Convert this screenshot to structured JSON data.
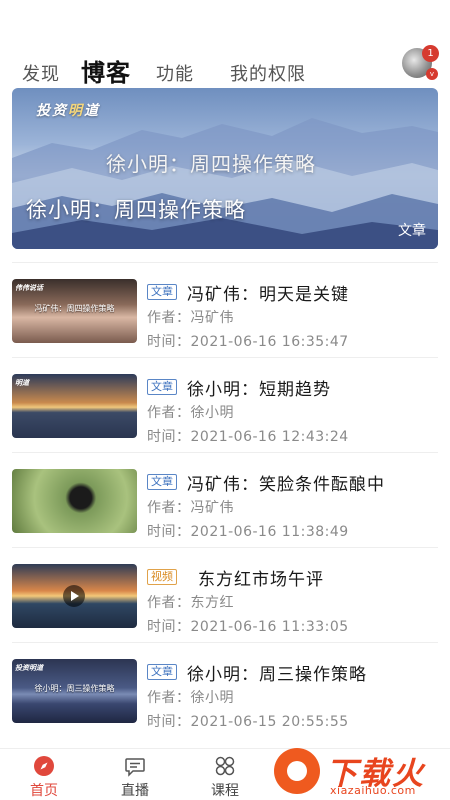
{
  "top_tabs": [
    {
      "label": "发现",
      "active": false
    },
    {
      "label": "博客",
      "active": true
    },
    {
      "label": "功能",
      "active": false
    },
    {
      "label": "我的权限",
      "active": false
    }
  ],
  "notification_count": "1",
  "vip_mark": "v",
  "banner": {
    "logo_text_a": "投资",
    "logo_text_b": "明",
    "logo_text_c": "道",
    "overlay_title": "徐小明：周四操作策略",
    "title": "徐小明：周四操作策略",
    "type": "文章"
  },
  "articles": [
    {
      "tag": "文章",
      "tag_kind": "article",
      "title": "冯矿伟：明天是关键",
      "author": "作者：冯矿伟",
      "time": "时间：2021-06-16 16:35:47",
      "thumb_text": "冯矿伟：周四操作策略",
      "thumb_brand": "伟伟说话"
    },
    {
      "tag": "文章",
      "tag_kind": "article",
      "title": "徐小明：短期趋势",
      "author": "作者：徐小明",
      "time": "时间：2021-06-16 12:43:24",
      "thumb_text": "",
      "thumb_brand": "明道"
    },
    {
      "tag": "文章",
      "tag_kind": "article",
      "title": "冯矿伟：笑脸条件酝酿中",
      "author": "作者：冯矿伟",
      "time": "时间：2021-06-16 11:38:49",
      "thumb_text": "",
      "thumb_brand": ""
    },
    {
      "tag": "视频",
      "tag_kind": "video",
      "title": "东方红市场午评",
      "author": "作者：东方红",
      "time": "时间：2021-06-16 11:33:05",
      "thumb_text": "",
      "thumb_brand": ""
    },
    {
      "tag": "文章",
      "tag_kind": "article",
      "title": "徐小明：周三操作策略",
      "author": "作者：徐小明",
      "time": "时间：2021-06-15 20:55:55",
      "thumb_text": "徐小明：周三操作策略",
      "thumb_brand": "投资明道"
    }
  ],
  "bottom_nav": [
    {
      "label": "首页",
      "icon": "compass-icon",
      "active": true
    },
    {
      "label": "直播",
      "icon": "chat-bubble-icon",
      "active": false
    },
    {
      "label": "课程",
      "icon": "grid-icon",
      "active": false
    }
  ],
  "watermark": {
    "name": "下载火",
    "url": "xiazaihuo.com"
  },
  "colors": {
    "accent": "#e0483c",
    "tag_article": "#3f73bf",
    "tag_video": "#d98a1f"
  }
}
